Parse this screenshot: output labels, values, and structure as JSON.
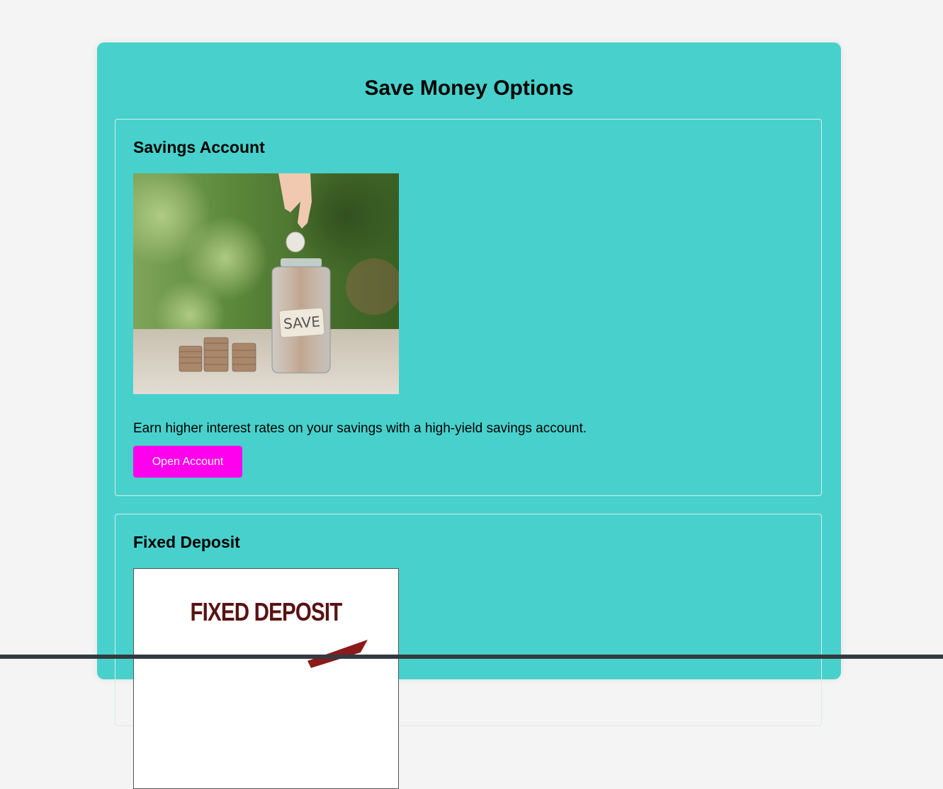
{
  "page": {
    "title": "Save Money Options"
  },
  "options": [
    {
      "title": "Savings Account",
      "image_label": "SAVE",
      "description": "Earn higher interest rates on your savings with a high-yield savings account.",
      "button_label": "Open Account"
    },
    {
      "title": "Fixed Deposit",
      "image_label": "FIXED DEPOSIT"
    }
  ],
  "colors": {
    "page_background": "#f4f4f4",
    "panel_background": "#48d1cc",
    "button_background": "#ff00ee",
    "button_text": "#ffffff",
    "fixed_deposit_text": "#5a1212"
  }
}
